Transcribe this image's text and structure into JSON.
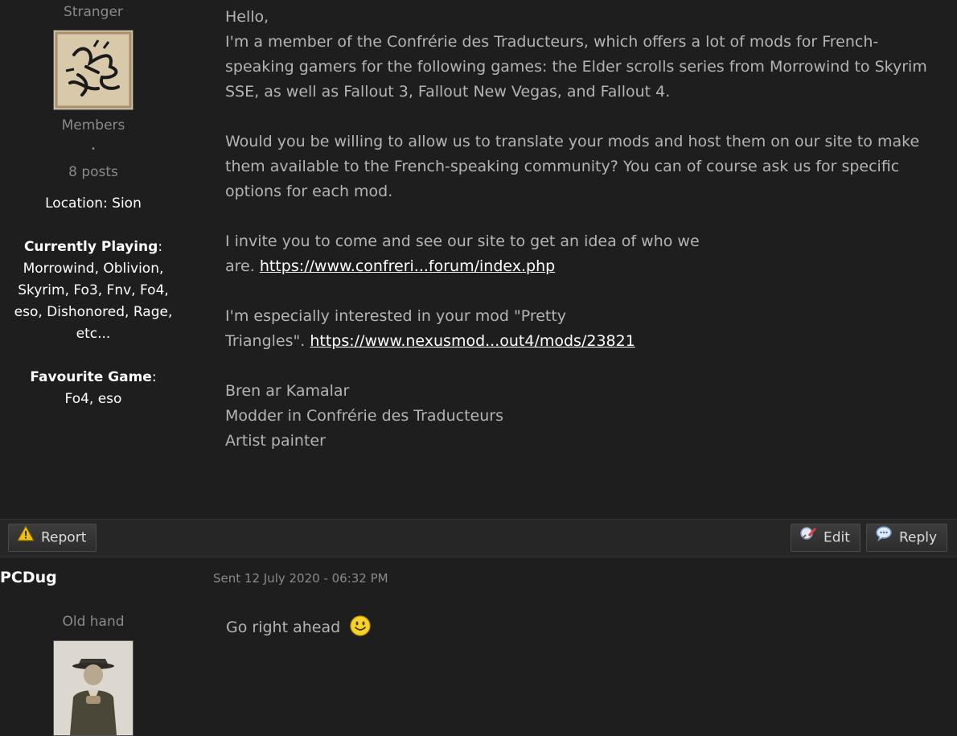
{
  "post1": {
    "author": {
      "title": "Stranger",
      "group": "Members",
      "bullet": "•",
      "posts": "8 posts",
      "location_label": "Location",
      "location_value": "Sion",
      "playing_label": "Currently Playing",
      "playing_value": "Morrowind, Oblivion, Skyrim, Fo3, Fnv, Fo4, eso, Dishonored, Rage, etc...",
      "fav_label": "Favourite Game",
      "fav_value": "Fo4, eso"
    },
    "body": {
      "greeting": "Hello,",
      "p1": "I'm a member of the Confrérie des Traducteurs, which offers a lot of mods for French-speaking gamers for the following games: the Elder scrolls series from Morrowind to Skyrim SSE, as well as Fallout 3, Fallout New Vegas, and Fallout 4.",
      "p2": "Would you be willing to allow us to translate your mods and host them on our site to make them available to the French-speaking community? You can of course ask us for specific options for each mod.",
      "p3_line1": "I invite you to come and see our site to get an idea of who we",
      "p3_prefix": "are. ",
      "p3_link": "https://www.confreri...forum/index.php",
      "p4_line1": "I'm especially interested in your mod \"Pretty",
      "p4_prefix": "Triangles\". ",
      "p4_link": "https://www.nexusmod...out4/mods/23821",
      "sig1": "Bren ar Kamalar",
      "sig2": "Modder in Confrérie des Traducteurs",
      "sig3": "Artist painter"
    }
  },
  "actions": {
    "report": "Report",
    "edit": "Edit",
    "reply": "Reply"
  },
  "post2": {
    "author": "PCDug",
    "date": "Sent 12 July 2020 - 06:32 PM",
    "role": "Old hand",
    "body": "Go right ahead"
  },
  "colors": {
    "background": "#1e1e1e",
    "text": "#b4b4b4",
    "link": "#ffffff",
    "muted": "#8a8a8a"
  }
}
